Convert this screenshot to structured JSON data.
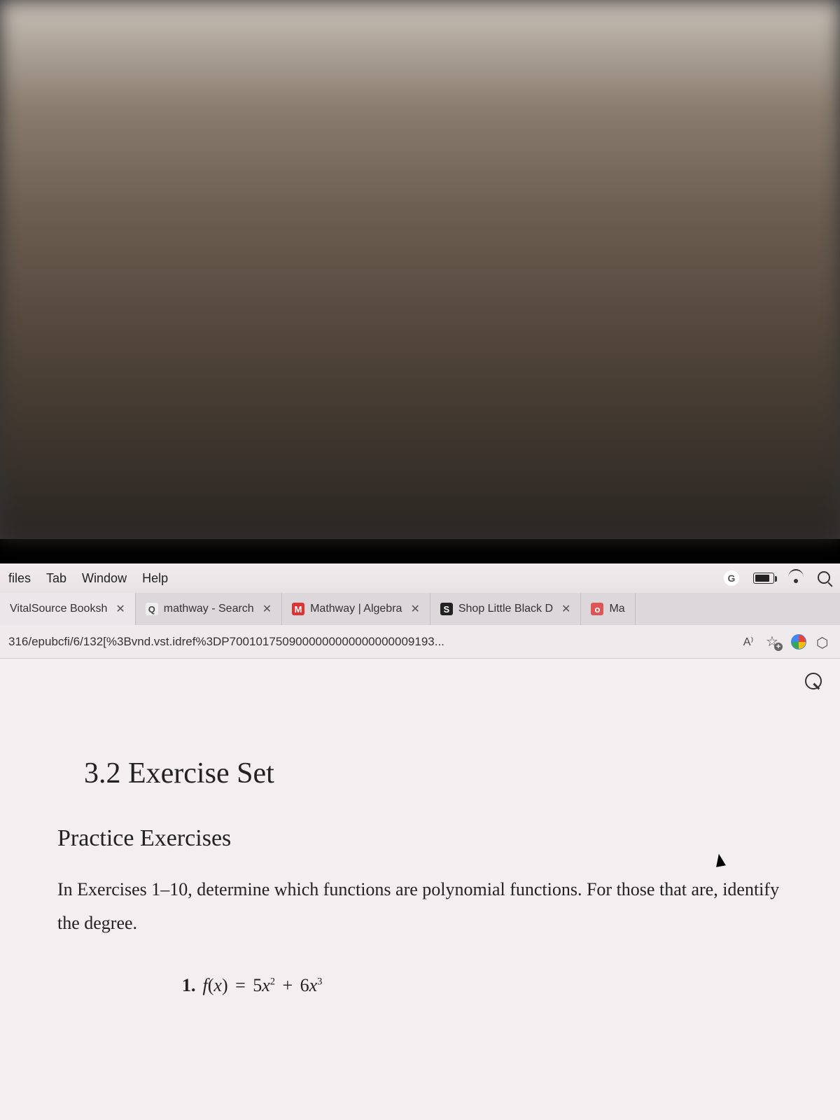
{
  "menubar": {
    "items": [
      "files",
      "Tab",
      "Window",
      "Help"
    ]
  },
  "tabs": [
    {
      "label": "VitalSource Booksh",
      "favicon": "",
      "active": true
    },
    {
      "label": "mathway - Search",
      "favicon": "Q",
      "favicon_class": "favicon-search",
      "active": false
    },
    {
      "label": "Mathway | Algebra",
      "favicon": "M",
      "favicon_class": "favicon-m",
      "active": false
    },
    {
      "label": "Shop Little Black D",
      "favicon": "S",
      "favicon_class": "favicon-s",
      "active": false
    },
    {
      "label": "Ma",
      "favicon": "o",
      "favicon_class": "favicon-o",
      "active": false,
      "no_close": true
    }
  ],
  "address": {
    "url": "316/epubcfi/6/132[%3Bvnd.vst.idref%3DP7001017509000000000000000009193...",
    "read_aloud": "A⁾"
  },
  "page": {
    "title": "3.2 Exercise Set",
    "subhead": "Practice Exercises",
    "instruction": "In Exercises 1–10, determine which functions are polynomial functions. For those that are, identify the degree.",
    "ex1_num": "1.",
    "ex1_fx": "f",
    "ex1_arg": "x",
    "ex1_eq": "=",
    "ex1_t1_coef": "5",
    "ex1_t1_var": "x",
    "ex1_t1_exp": "2",
    "ex1_plus": "+",
    "ex1_t2_coef": "6",
    "ex1_t2_var": "x",
    "ex1_t2_exp": "3"
  }
}
